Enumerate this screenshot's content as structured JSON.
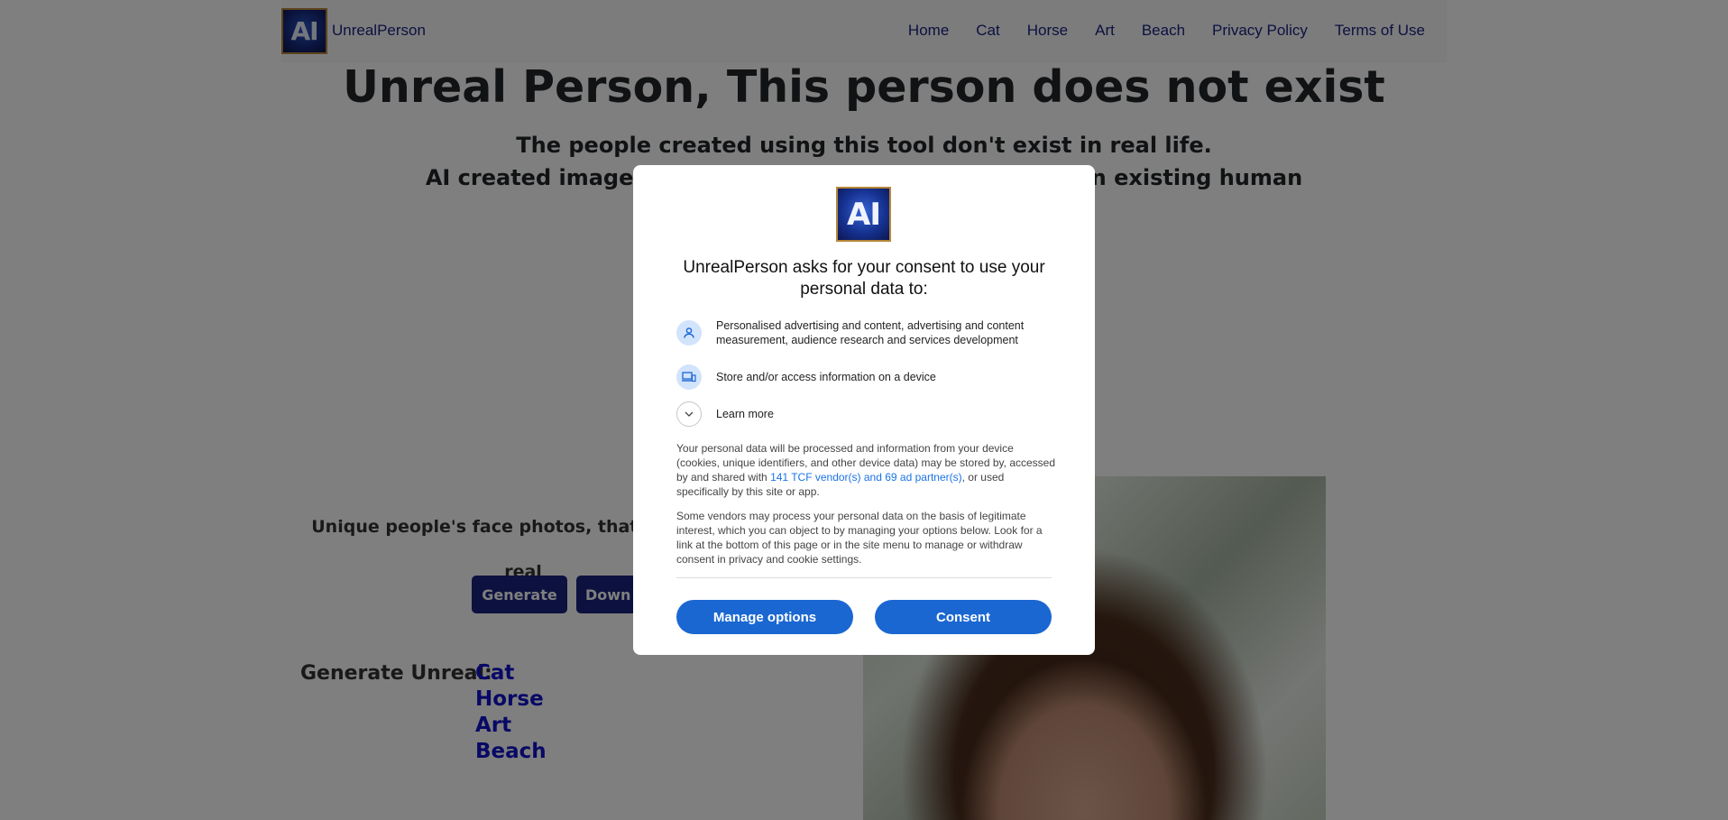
{
  "nav": {
    "logo_text": "AI",
    "brand": "UnrealPerson",
    "links": [
      "Home",
      "Cat",
      "Horse",
      "Art",
      "Beach",
      "Privacy Policy",
      "Terms of Use"
    ]
  },
  "hero": {
    "title": "Unreal Person, This person does not exist",
    "subtitle_1": "The people created using this tool don't exist in real life.",
    "subtitle_2": "AI created images u"
  },
  "hero_tail": "non existing human",
  "left": {
    "description": "Unique people's face photos, that do not ex",
    "description_tail": "real",
    "generate_button": "Generate",
    "download_button": "Down"
  },
  "generate_unreal": {
    "label": "Generate Unreal:",
    "links": [
      "Cat",
      "Horse",
      "Art",
      "Beach"
    ]
  },
  "dialog": {
    "logo_text": "AI",
    "title": "UnrealPerson asks for your consent to use your personal data to:",
    "purposes": [
      {
        "icon": "person-icon",
        "text": "Personalised advertising and content, advertising and content measurement, audience research and services development"
      },
      {
        "icon": "devices-icon",
        "text": "Store and/or access information on a device"
      }
    ],
    "learn_more": "Learn more",
    "info_1_pre": "Your personal data will be processed and information from your device (cookies, unique identifiers, and other device data) may be stored by, accessed by and shared with ",
    "info_1_link": "141 TCF vendor(s) and 69 ad partner(s)",
    "info_1_post": ", or used specifically by this site or app.",
    "info_2": "Some vendors may process your personal data on the basis of legitimate interest, which you can object to by managing your options below. Look for a link at the bottom of this page or in the site menu to manage or withdraw consent in privacy and cookie settings.",
    "manage_button": "Manage options",
    "consent_button": "Consent"
  },
  "colors": {
    "brand_dark": "#1a237e",
    "consent_blue": "#1a67d2",
    "link_blue": "#1a73e8"
  }
}
